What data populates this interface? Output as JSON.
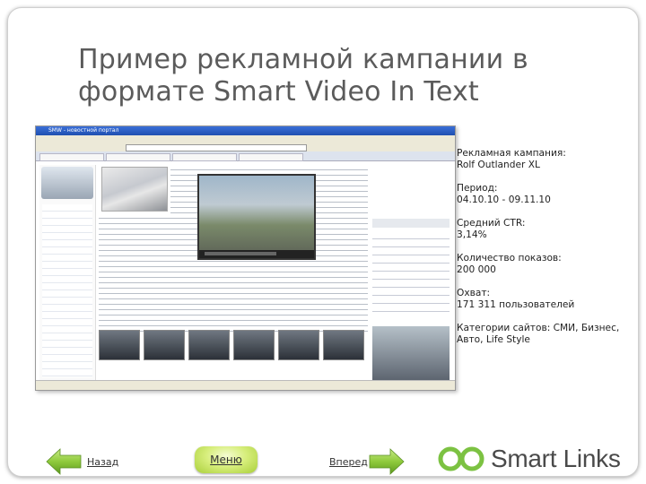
{
  "slide": {
    "title": "Пример рекламной кампании в формате Smart Video In Text"
  },
  "screenshot": {
    "window_title": "SMW - новостной портал"
  },
  "info": [
    {
      "label": "Рекламная кампания:",
      "value": "Rolf Outlander XL"
    },
    {
      "label": "Период:",
      "value": "04.10.10 - 09.11.10"
    },
    {
      "label": "Средний CTR:",
      "value": "3,14%"
    },
    {
      "label": "Количество показов:",
      "value": "200 000"
    },
    {
      "label": "Охват:",
      "value": "171 311 пользователей"
    },
    {
      "label": "Категории сайтов: СМИ, Бизнес, Авто, Life Style",
      "value": ""
    }
  ],
  "nav": {
    "back_label": "Назад",
    "menu_label": "Меню",
    "forward_label": "Вперед"
  },
  "logo": {
    "text": "Smart Links"
  },
  "colors": {
    "accent_green": "#7cc242",
    "title_gray": "#5b5b5b",
    "logo_gray": "#4a4a4a"
  }
}
